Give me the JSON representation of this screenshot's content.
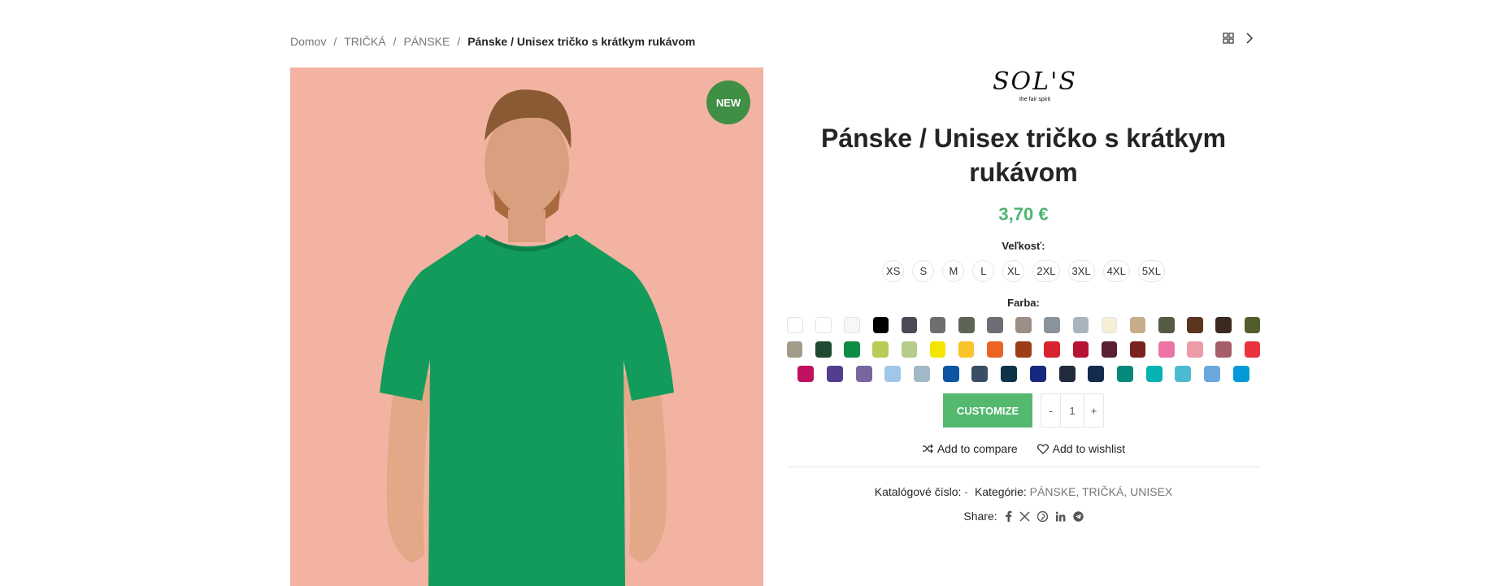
{
  "breadcrumb": {
    "items": [
      "Domov",
      "TRIČKÁ",
      "PÁNSKE"
    ],
    "current": "Pánske / Unisex tričko s krátkym rukávom",
    "separator": "/"
  },
  "nav_icons": [
    "grid-icon",
    "chevron-right-icon"
  ],
  "image": {
    "badge": "NEW",
    "background": "#f3b3a2",
    "shirt_color": "#139b5c"
  },
  "brand": {
    "name": "SOL'S",
    "tagline": "the fair spirit"
  },
  "product": {
    "title": "Pánske / Unisex tričko s krátkym rukávom",
    "price": "3,70 €"
  },
  "size": {
    "label": "Veľkosť:",
    "options": [
      "XS",
      "S",
      "M",
      "L",
      "XL",
      "2XL",
      "3XL",
      "4XL",
      "5XL"
    ]
  },
  "color": {
    "label": "Farba:",
    "rows": [
      [
        "#ffffff",
        "#ffffff",
        "#f7f7f7",
        "#000000",
        "#4a4b55",
        "#6e6e6e",
        "#5e6453",
        "#6d6e75",
        "#9b8f87",
        "#8a939c",
        "#a9b5bd",
        "#f4efd6",
        "#c6ad8a",
        "#535b45",
        "#5c3420",
        "#3b2a20",
        "#515e2c"
      ],
      [
        "#a19d8a",
        "#1f4a31",
        "#0d8c45",
        "#b9cc58",
        "#b4cc8c",
        "#f4e500",
        "#f8c42a",
        "#ec6325",
        "#9c3d16",
        "#d9232f",
        "#b51233",
        "#5b1f36",
        "#7a231d",
        "#ec74a4",
        "#ed9ba7",
        "#a75e6b",
        "#e8343e"
      ],
      [
        "#c1105f",
        "#533e8d",
        "#7a65a0",
        "#a0c7e8",
        "#a2b8c6",
        "#0c55a2",
        "#3b4e63",
        "#0d3348",
        "#17287f",
        "#222b3e",
        "#132c4e",
        "#04897a",
        "#06b3b3",
        "#4bbbd2",
        "#6aa8dd",
        "#039ad8"
      ]
    ]
  },
  "cart": {
    "customize_label": "CUSTOMIZE",
    "qty_minus": "-",
    "qty_value": "1",
    "qty_plus": "+"
  },
  "actions": {
    "compare": "Add to compare",
    "wishlist": "Add to wishlist"
  },
  "meta": {
    "sku_label": "Katalógové číslo:",
    "sku_value": "-",
    "categories_label": "Kategórie:",
    "categories": [
      "PÁNSKE",
      "TRIČKÁ",
      "UNISEX"
    ]
  },
  "share": {
    "label": "Share:",
    "networks": [
      "facebook-icon",
      "x-icon",
      "pinterest-icon",
      "linkedin-icon",
      "telegram-icon"
    ]
  }
}
